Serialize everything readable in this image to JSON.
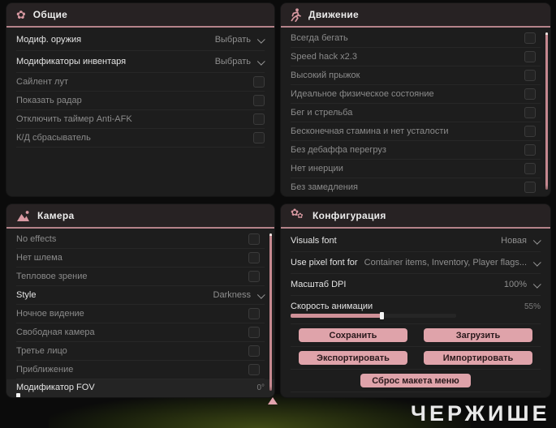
{
  "colors": {
    "accent": "#d999a2",
    "header_underline": "#b5838a",
    "button_bg": "#dfa3aa",
    "panel_bg": "#1d1d1d"
  },
  "watermark": "ЧЕРЖИШЕ",
  "panels": {
    "general": {
      "title": "Общие",
      "rows": [
        {
          "label": "Модиф. оружия",
          "value": "Выбрать"
        },
        {
          "label": "Модификаторы инвентаря",
          "value": "Выбрать"
        },
        {
          "label": "Сайлент лут"
        },
        {
          "label": "Показать радар"
        },
        {
          "label": "Отключить таймер Anti-AFK"
        },
        {
          "label": "К/Д сбрасыватель"
        }
      ]
    },
    "movement": {
      "title": "Движение",
      "rows": [
        {
          "label": "Всегда бегать"
        },
        {
          "label": "Speed hack x2.3"
        },
        {
          "label": "Высокий прыжок"
        },
        {
          "label": "Идеальное физическое состояние"
        },
        {
          "label": "Бег и стрельба"
        },
        {
          "label": "Бесконечная стамина и нет усталости"
        },
        {
          "label": "Без дебаффа перегруз"
        },
        {
          "label": "Нет инерции"
        },
        {
          "label": "Без замедления"
        }
      ]
    },
    "camera": {
      "title": "Камера",
      "rows": [
        {
          "label": "No effects"
        },
        {
          "label": "Нет шлема"
        },
        {
          "label": "Тепловое зрение"
        },
        {
          "label": "Style",
          "value": "Darkness"
        },
        {
          "label": "Ночное видение"
        },
        {
          "label": "Свободная камера"
        },
        {
          "label": "Третье лицо"
        },
        {
          "label": "Приближение"
        },
        {
          "label": "Модификатор FOV",
          "value": "0°",
          "slider_percent": 0
        }
      ]
    },
    "config": {
      "title": "Конфигурация",
      "rows": [
        {
          "label": "Visuals font",
          "value": "Новая"
        },
        {
          "label": "Use pixel font for",
          "value": "Container items, Inventory, Player flags..."
        },
        {
          "label": "Масштаб DPI",
          "value": "100%"
        },
        {
          "label": "Скорость анимации",
          "value": "55%",
          "slider_percent": 55
        }
      ],
      "buttons": [
        "Сохранить",
        "Загрузить",
        "Экспортировать",
        "Импортировать",
        "Сброс макета меню"
      ]
    }
  }
}
